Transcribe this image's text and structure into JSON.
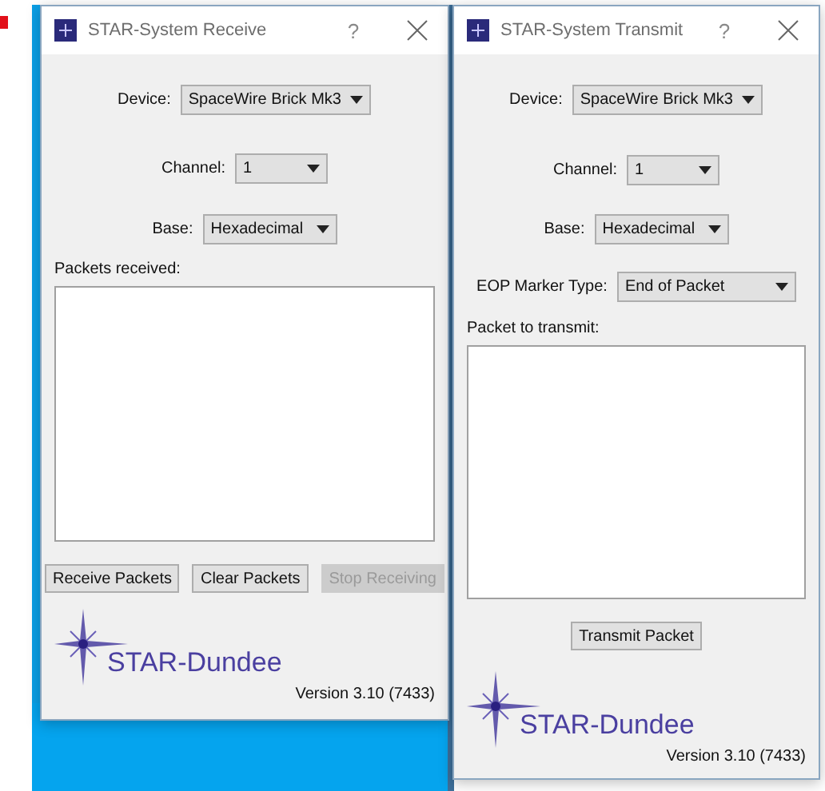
{
  "windows": [
    {
      "kind": "receive",
      "title": "STAR-System Receive",
      "help": "?",
      "fields": [
        {
          "label": "Device:",
          "value": "SpaceWire Brick Mk3"
        },
        {
          "label": "Channel:",
          "value": "1"
        },
        {
          "label": "Base:",
          "value": "Hexadecimal"
        }
      ],
      "area_label": "Packets received:",
      "buttons": [
        {
          "label": "Receive Packets",
          "disabled": false
        },
        {
          "label": "Clear Packets",
          "disabled": false
        },
        {
          "label": "Stop Receiving",
          "disabled": true
        }
      ],
      "logo_text": "STAR-Dundee",
      "version": "Version 3.10 (7433)"
    },
    {
      "kind": "transmit",
      "title": "STAR-System Transmit",
      "help": "?",
      "fields": [
        {
          "label": "Device:",
          "value": "SpaceWire Brick Mk3"
        },
        {
          "label": "Channel:",
          "value": "1"
        },
        {
          "label": "Base:",
          "value": "Hexadecimal"
        },
        {
          "label": "EOP Marker Type:",
          "value": "End of Packet"
        }
      ],
      "area_label": "Packet to transmit:",
      "buttons": [
        {
          "label": "Transmit Packet",
          "disabled": false
        }
      ],
      "logo_text": "STAR-Dundee",
      "version": "Version 3.10 (7433)"
    }
  ]
}
